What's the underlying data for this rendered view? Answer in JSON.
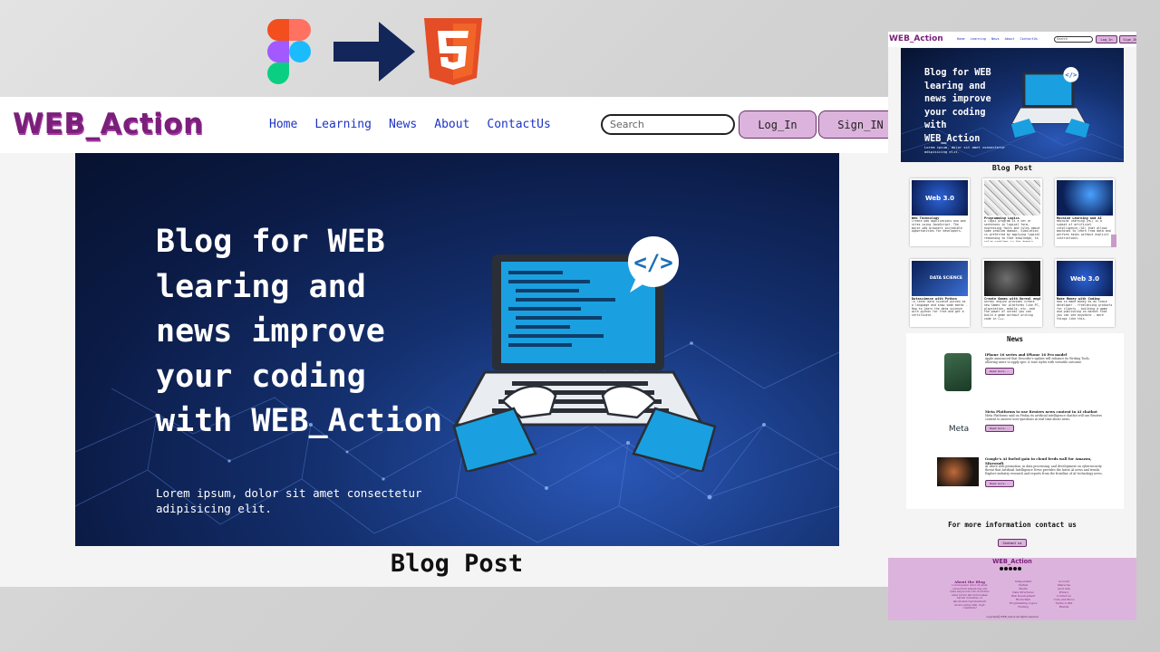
{
  "colors": {
    "brand": "#7a1f7a",
    "nav_link": "#1d34c4",
    "button_bg": "#dcb3dc",
    "button_border": "#6b2d6b",
    "hero_dark": "#0b1b46",
    "arrow": "#13265a",
    "html5": "#e44d26"
  },
  "icons": {
    "figma": "figma-logo-icon",
    "arrow": "right-arrow-icon",
    "html5": "html5-logo-icon"
  },
  "site": {
    "brand": "WEB_Action",
    "nav": [
      "Home",
      "Learning",
      "News",
      "About",
      "ContactUs"
    ],
    "search_placeholder": "Search",
    "login_label": "Log_In",
    "signup_label": "Sign_IN",
    "hero": {
      "title": "Blog for WEB learing and news improve your coding with WEB_Action",
      "subtitle": "Lorem ipsum, dolor sit amet consectetur adipisicing elit."
    },
    "blog_heading": "Blog Post"
  },
  "preview": {
    "brand": "WEB_Action",
    "nav": [
      "Home",
      "Learning",
      "News",
      "About",
      "ContactUs"
    ],
    "search_placeholder": "Search",
    "login_label": "Log_In",
    "signup_label": "Sign_IN",
    "hero_title": "Blog for WEB learing and news improve your coding with WEB_Action",
    "hero_subtitle": "Lorem ipsum, dolor sit amet consectetur adipisicing elit.",
    "blog_heading": "Blog Post",
    "cards": [
      {
        "title": "Web Technology",
        "body": "Create web applications and web sites using JavaScript. The major web browsers incredible opportunities for developers.",
        "thumb_label": "Web 3.0"
      },
      {
        "title": "Programming Logics",
        "body": "A logic program is a set of sentences in logical form, expressing facts and rules about some problem domain. Simulation is preferred by applying logical reasoning to that knowledge, to solve problems in the domain.",
        "thumb_label": ""
      },
      {
        "title": "Machine Learning and AI",
        "body": "Machine learning (ML) is a subset of artificial intelligence (AI) that allows machines to learn from data and perform tasks without explicit instructions.",
        "thumb_label": ""
      },
      {
        "title": "Datascience with Python",
        "body": "To learn data science python as a language and know some maths - How to learn the data science with python for free and get a certificate.",
        "thumb_label": "DATA SCIENCE"
      },
      {
        "title": "Create Games with Unreal engine 5",
        "body": "Unreal engine provides create new Games for platforms like PC, playstation, mobile, etc. and the power of unreal you can build a game without writing code in C++.",
        "thumb_label": ""
      },
      {
        "title": "Make Money with Coding",
        "body": "How to make money as an Indie developer - freelancing products for clients - building a game and publishing on market that you can see anywhere - more things like this.",
        "thumb_label": "Web 3.0"
      }
    ],
    "news_heading": "News",
    "news": [
      {
        "title": "iPhone 16 series and iPhone 16 Pro model",
        "desc": "Apple announced that Describe's update will enhance its Writing Tools, allowing users to apply spec & tone styles with versatile outcome.",
        "button": "Read more..."
      },
      {
        "title": "Meta Platforms to use Reuters news content in AI chatbot",
        "desc": "Meta Platforms said on Friday its artificial intelligence chatbot will use Reuters content to answer user questions in real time about news.",
        "button": "Read more..."
      },
      {
        "title": "Google's AI fueled gain in cloud feeds wall for Amazon, Microsoft",
        "desc": "AI drove web promotion, in data processing, and development on cybersecurity threat that Artificial Intelligence News provides the latest AI news and trends. Explore industry research and reports from the frontline of AI technology news.",
        "button": "Read more..."
      }
    ],
    "news_thumb_label": "Meta",
    "contact_text": "For more information contact us",
    "contact_button": "Contact us",
    "footer": {
      "brand": "WEB_Action",
      "about_heading": "About the Blog",
      "about_text": "Lorem ipsum dolor sit amet consectetur adipisicing elit. Quia neque iste odio doloribus amet rerum laborum beatae harum molestias, et laboriosam reprehenderit facere natus nihil, fugit cupiditate!",
      "col1": [
        "Independent",
        "Unified",
        "Media",
        "Data Structures",
        "Web Development",
        "Blockchain",
        "Programming Logics",
        "Hosting"
      ],
      "col2": [
        "Account",
        "Share the",
        "good side",
        "Privacy",
        "Contact us",
        "Code and Move",
        "Terms to Bid",
        "Brands"
      ],
      "copyright": "copyright@ WEB_Action All rights reserved"
    }
  }
}
